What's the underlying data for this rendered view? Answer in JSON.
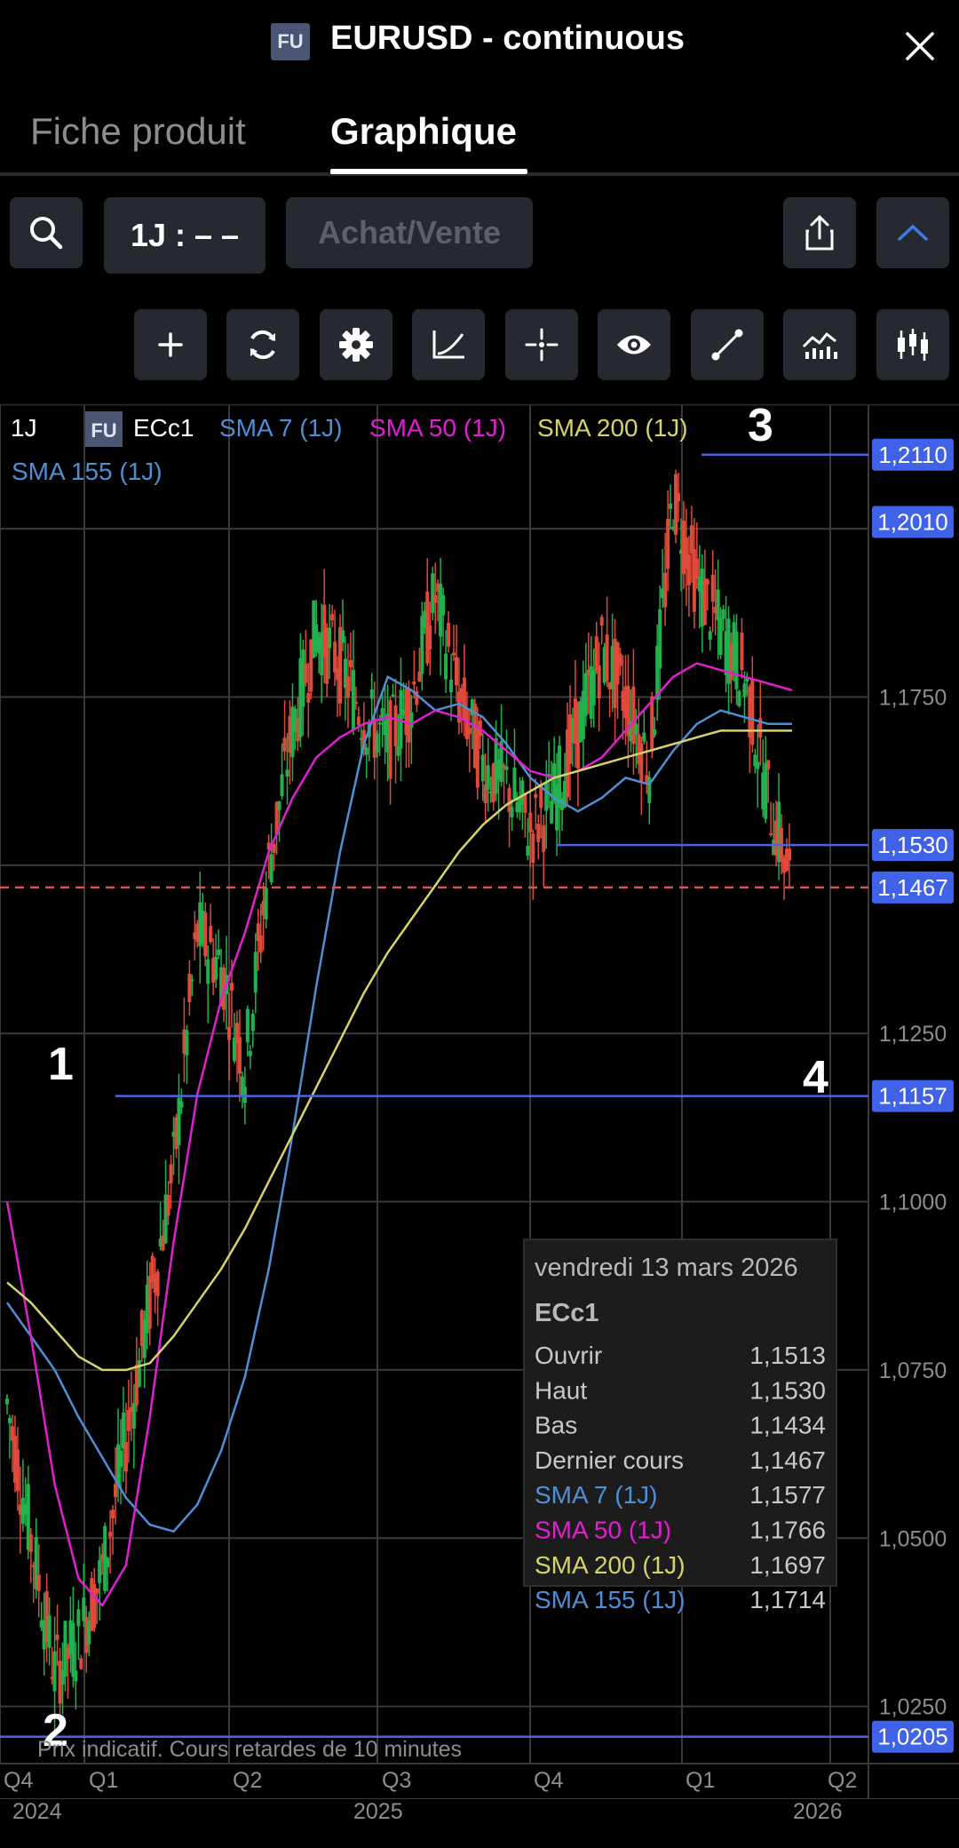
{
  "header": {
    "badge": "FU",
    "title": "EURUSD - continuous",
    "close_icon": "close-icon"
  },
  "tabs": [
    {
      "label": "Fiche produit",
      "active": false
    },
    {
      "label": "Graphique",
      "active": true
    }
  ],
  "toolbar": {
    "interval_label": "1J : – –",
    "trade_label": "Achat/Vente",
    "icons": [
      "search-icon",
      "share-icon",
      "chevron-up-icon"
    ]
  },
  "tools": [
    "plus-icon",
    "refresh-icon",
    "gear-icon",
    "curve-icon",
    "crosshair-icon",
    "eye-icon",
    "line-draw-icon",
    "indicator-icon",
    "candles-icon"
  ],
  "chart_data": {
    "type": "line",
    "instrument_badge": "FU",
    "interval": "1J",
    "symbol": "ECc1",
    "legend": [
      {
        "name": "SMA 7 (1J)",
        "color": "#4f8fd6"
      },
      {
        "name": "SMA 50 (1J)",
        "color": "#e01fd0"
      },
      {
        "name": "SMA 200 (1J)",
        "color": "#d6d36a"
      },
      {
        "name": "SMA 155 (1J)",
        "color": "#4f8fd6"
      }
    ],
    "y_ticks": [
      "1,0250",
      "1,0500",
      "1,0750",
      "1,1000",
      "1,1250",
      "1,1750"
    ],
    "y_range": [
      1.0165,
      1.2185
    ],
    "x_ticks": [
      "Q4",
      "Q1",
      "Q2",
      "Q3",
      "Q4",
      "Q1",
      "Q2"
    ],
    "years": [
      "2024",
      "2025",
      "2026"
    ],
    "price_lines": [
      {
        "value": 1.211,
        "label": "1,2110",
        "color": "#4f63e0"
      },
      {
        "value": 1.201,
        "label": "1,2010",
        "color": "#4f63e0"
      },
      {
        "value": 1.153,
        "label": "1,1530",
        "color": "#4f63e0"
      },
      {
        "value": 1.1467,
        "label": "1,1467",
        "color": "#e05050",
        "dashed": true
      },
      {
        "value": 1.1157,
        "label": "1,1157",
        "color": "#4f63e0"
      },
      {
        "value": 1.0205,
        "label": "1,0205",
        "color": "#4f63e0"
      }
    ],
    "annotations": [
      "1",
      "2",
      "3",
      "4"
    ],
    "footnote": "Prix indicatif. Cours retardes de 10 minutes",
    "tooltip": {
      "date": "vendredi 13 mars 2026",
      "symbol": "ECc1",
      "rows": [
        {
          "label": "Ouvrir",
          "value": "1,1513",
          "color": "#c8c8c8"
        },
        {
          "label": "Haut",
          "value": "1,1530",
          "color": "#c8c8c8"
        },
        {
          "label": "Bas",
          "value": "1,1434",
          "color": "#c8c8c8"
        },
        {
          "label": "Dernier cours",
          "value": "1,1467",
          "color": "#c8c8c8"
        },
        {
          "label": "SMA 7 (1J)",
          "value": "1,1577",
          "color": "#4f8fd6"
        },
        {
          "label": "SMA 50 (1J)",
          "value": "1,1766",
          "color": "#e01fd0"
        },
        {
          "label": "SMA 200 (1J)",
          "value": "1,1697",
          "color": "#d6d36a"
        },
        {
          "label": "SMA 155 (1J)",
          "value": "1,1714",
          "color": "#4f8fd6"
        }
      ]
    },
    "series": [
      {
        "color": "#4f8fd6",
        "values": [
          1.085,
          1.08,
          1.075,
          1.068,
          1.062,
          1.056,
          1.052,
          1.051,
          1.055,
          1.063,
          1.074,
          1.09,
          1.11,
          1.132,
          1.152,
          1.168,
          1.178,
          1.176,
          1.173,
          1.174,
          1.172,
          1.168,
          1.163,
          1.16,
          1.158,
          1.16,
          1.163,
          1.162,
          1.167,
          1.171,
          1.173,
          1.172,
          1.171,
          1.171
        ]
      },
      {
        "color": "#e01fd0",
        "values": [
          1.1,
          1.08,
          1.058,
          1.044,
          1.04,
          1.046,
          1.068,
          1.094,
          1.116,
          1.13,
          1.14,
          1.152,
          1.16,
          1.166,
          1.169,
          1.171,
          1.172,
          1.171,
          1.173,
          1.172,
          1.17,
          1.167,
          1.164,
          1.163,
          1.164,
          1.166,
          1.17,
          1.174,
          1.178,
          1.18,
          1.179,
          1.178,
          1.177,
          1.176
        ]
      },
      {
        "color": "#d6d36a",
        "values": [
          1.088,
          1.085,
          1.081,
          1.077,
          1.075,
          1.075,
          1.076,
          1.08,
          1.085,
          1.09,
          1.096,
          1.103,
          1.11,
          1.117,
          1.124,
          1.131,
          1.137,
          1.142,
          1.147,
          1.152,
          1.156,
          1.159,
          1.161,
          1.163,
          1.164,
          1.165,
          1.166,
          1.167,
          1.168,
          1.169,
          1.17,
          1.17,
          1.17,
          1.17
        ]
      },
      {
        "color": "#ffffff",
        "values": [
          1.07,
          1.05,
          1.03,
          1.035,
          1.045,
          1.065,
          1.085,
          1.105,
          1.14,
          1.135,
          1.12,
          1.15,
          1.17,
          1.185,
          1.18,
          1.172,
          1.168,
          1.175,
          1.19,
          1.175,
          1.165,
          1.162,
          1.155,
          1.16,
          1.17,
          1.182,
          1.175,
          1.165,
          1.205,
          1.192,
          1.185,
          1.178,
          1.16,
          1.147
        ]
      }
    ]
  }
}
